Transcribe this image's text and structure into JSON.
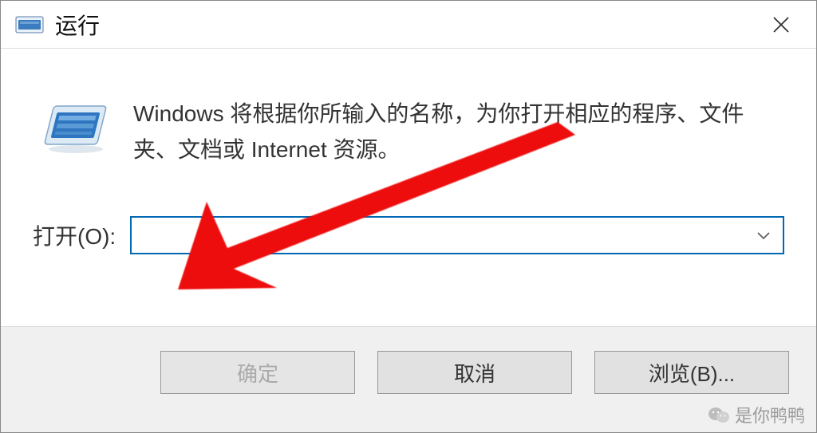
{
  "titlebar": {
    "title": "运行"
  },
  "body": {
    "description": "Windows 将根据你所输入的名称，为你打开相应的程序、文件夹、文档或 Internet 资源。",
    "open_label": "打开(O):",
    "input_value": ""
  },
  "buttons": {
    "ok": "确定",
    "cancel": "取消",
    "browse": "浏览(B)..."
  },
  "watermark": {
    "text": "是你鸭鸭"
  }
}
